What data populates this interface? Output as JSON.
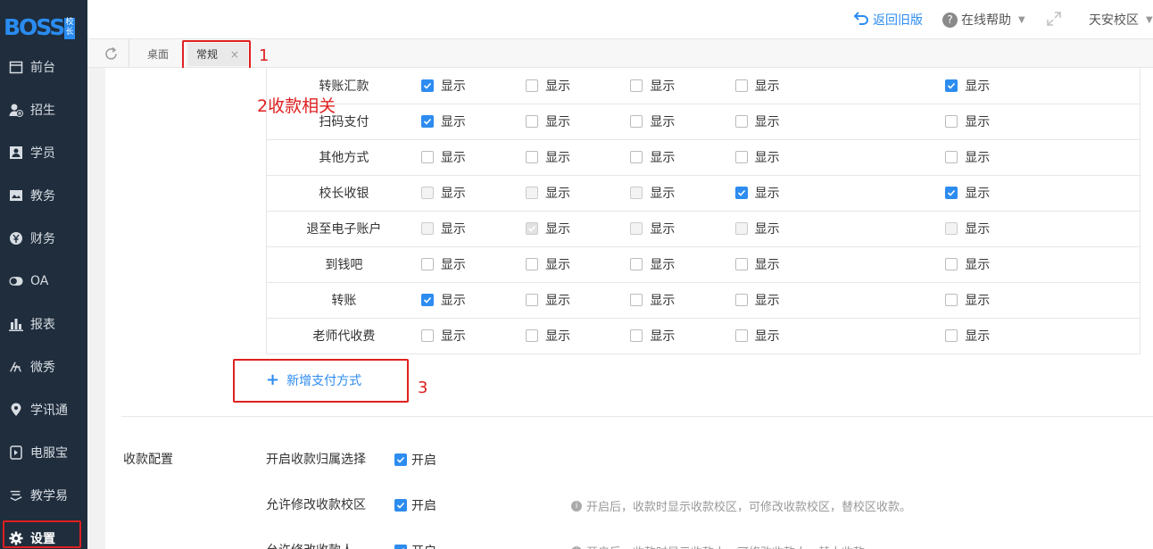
{
  "sidebar": {
    "logo": "BOSS",
    "logo_sub": "校长",
    "items": [
      {
        "label": "前台",
        "icon": "calendar-icon"
      },
      {
        "label": "招生",
        "icon": "user-add-icon"
      },
      {
        "label": "学员",
        "icon": "student-card-icon"
      },
      {
        "label": "教务",
        "icon": "book-icon"
      },
      {
        "label": "财务",
        "icon": "yen-icon"
      },
      {
        "label": "OA",
        "icon": "toggle-icon"
      },
      {
        "label": "报表",
        "icon": "bar-chart-icon"
      },
      {
        "label": "微秀",
        "icon": "xiu-icon"
      },
      {
        "label": "学讯通",
        "icon": "location-icon"
      },
      {
        "label": "电服宝",
        "icon": "phone-service-icon"
      },
      {
        "label": "教学易",
        "icon": "teach-icon"
      },
      {
        "label": "设置",
        "icon": "gear-icon"
      }
    ]
  },
  "topbar": {
    "back_old": "返回旧版",
    "help": "在线帮助",
    "campus": "天安校区"
  },
  "tabs": {
    "desktop": "桌面",
    "current": "常规",
    "close": "×"
  },
  "payment_table": {
    "check_label": "显示",
    "rows": [
      {
        "name": "转账汇款",
        "checks": [
          "on",
          "off",
          "off",
          "off",
          "on"
        ]
      },
      {
        "name": "扫码支付",
        "checks": [
          "on",
          "off",
          "off",
          "off",
          "off"
        ]
      },
      {
        "name": "其他方式",
        "checks": [
          "off",
          "off",
          "off",
          "off",
          "off"
        ]
      },
      {
        "name": "校长收银",
        "checks": [
          "dis",
          "dis",
          "dis",
          "on",
          "on"
        ]
      },
      {
        "name": "退至电子账户",
        "checks": [
          "dis",
          "disOn",
          "dis",
          "dis",
          "dis"
        ]
      },
      {
        "name": "到钱吧",
        "checks": [
          "off",
          "off",
          "off",
          "off",
          "off"
        ]
      },
      {
        "name": "转账",
        "checks": [
          "on",
          "off",
          "off",
          "off",
          "off"
        ]
      },
      {
        "name": "老师代收费",
        "checks": [
          "off",
          "off",
          "off",
          "off",
          "off"
        ]
      }
    ]
  },
  "add_payment": "新增支付方式",
  "config": {
    "title": "收款配置",
    "rows": [
      {
        "label": "开启收款归属选择",
        "check": "开启",
        "hint": ""
      },
      {
        "label": "允许修改收款校区",
        "check": "开启",
        "hint": "开启后，收款时显示收款校区，可修改收款校区，替校区收款。"
      },
      {
        "label": "允许修改收款人",
        "check": "开启",
        "hint": "开启后，收款时显示收款人，可修改收款人，替人收款。"
      }
    ]
  },
  "annotations": {
    "a1": "1",
    "a2": "2收款相关",
    "a3": "3"
  },
  "colors": {
    "accent": "#2d8cf0",
    "sidebar_bg": "#1f2d3d",
    "annotation_red": "#e02020"
  }
}
